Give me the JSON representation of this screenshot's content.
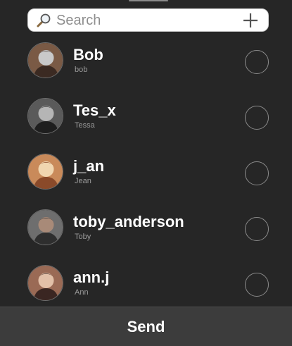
{
  "search": {
    "placeholder": "Search",
    "value": "",
    "search_icon": "magnifying-glass-icon",
    "add_icon": "plus-icon"
  },
  "contacts": [
    {
      "username": "Bob",
      "name": "bob",
      "selected": false,
      "avatar_colors": [
        "#7a5a45",
        "#3b2a22",
        "#c9c9c9"
      ]
    },
    {
      "username": "Tes_x",
      "name": "Tessa",
      "selected": false,
      "avatar_colors": [
        "#5a5a5a",
        "#1e1e1e",
        "#b5b5b5"
      ]
    },
    {
      "username": "j_an",
      "name": "Jean",
      "selected": false,
      "avatar_colors": [
        "#c98a5a",
        "#8a4a2a",
        "#f0d6b0"
      ]
    },
    {
      "username": "toby_anderson",
      "name": "Toby",
      "selected": false,
      "avatar_colors": [
        "#6e6e6e",
        "#2e2e2e",
        "#a88a78"
      ]
    },
    {
      "username": "ann.j",
      "name": "Ann",
      "selected": false,
      "avatar_colors": [
        "#9a6a55",
        "#3a2622",
        "#e2c0a8"
      ]
    }
  ],
  "footer": {
    "send_label": "Send"
  },
  "colors": {
    "background": "#262626",
    "footer_background": "#3c3c3c",
    "text_primary": "#ffffff",
    "text_secondary": "#9a9a9a"
  }
}
